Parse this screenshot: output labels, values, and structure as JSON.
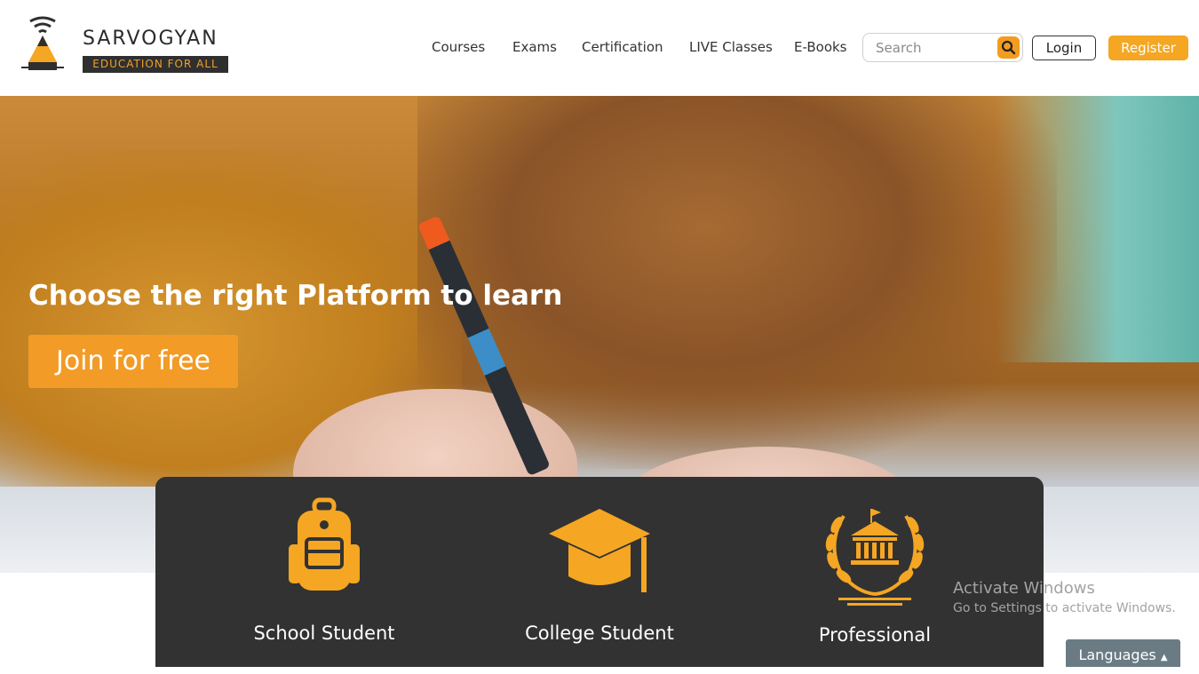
{
  "brand": {
    "name": "SARVOGYAN",
    "tagline": "EDUCATION FOR ALL",
    "accent_color": "#f5a623",
    "dark_color": "#323232"
  },
  "nav": {
    "items": [
      {
        "label": "Courses"
      },
      {
        "label": "Exams"
      },
      {
        "label": "Certification"
      },
      {
        "label": "LIVE Classes"
      },
      {
        "label": "E-Books"
      }
    ]
  },
  "search": {
    "placeholder": "Search",
    "icon": "search-icon"
  },
  "auth": {
    "login_label": "Login",
    "register_label": "Register"
  },
  "hero": {
    "title": "Choose the right Platform to learn",
    "cta_label": "Join for free"
  },
  "categories": [
    {
      "label": "School Student",
      "icon": "backpack-icon"
    },
    {
      "label": "College Student",
      "icon": "graduation-cap-icon"
    },
    {
      "label": "Professional",
      "icon": "university-laurel-icon"
    }
  ],
  "os_watermark": {
    "title": "Activate Windows",
    "subtitle": "Go to Settings to activate Windows."
  },
  "languages": {
    "label": "Languages"
  }
}
